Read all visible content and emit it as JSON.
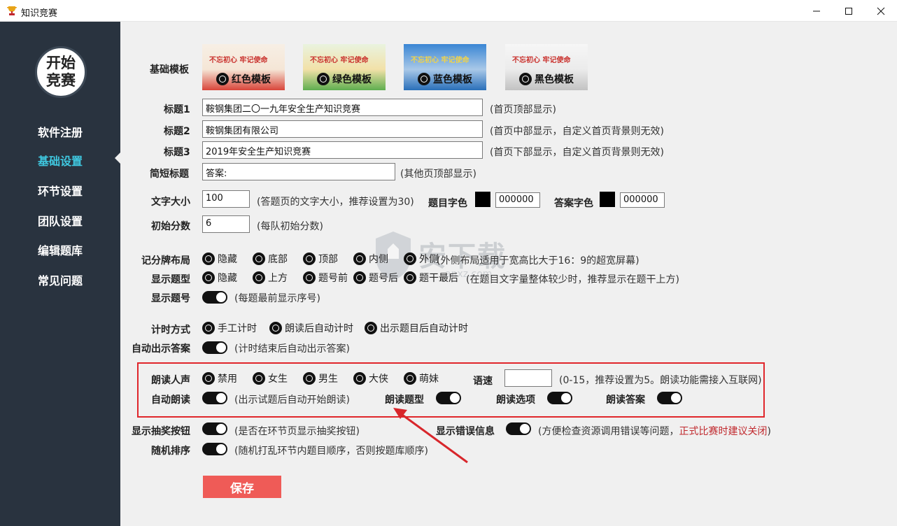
{
  "window": {
    "title": "知识竞赛"
  },
  "sidebar": {
    "logo_text": "开始竞赛",
    "items": [
      {
        "label": "软件注册",
        "active": false
      },
      {
        "label": "基础设置",
        "active": true
      },
      {
        "label": "环节设置",
        "active": false
      },
      {
        "label": "团队设置",
        "active": false
      },
      {
        "label": "编辑题库",
        "active": false
      },
      {
        "label": "常见问题",
        "active": false
      }
    ]
  },
  "template": {
    "label": "基础模板",
    "options": [
      {
        "label": "红色模板",
        "banner_text": "不忘初心 牢记使命",
        "color": "#d9453a"
      },
      {
        "label": "绿色模板",
        "banner_text": "不忘初心 牢记使命",
        "color": "#5fae4f"
      },
      {
        "label": "蓝色模板",
        "banner_text": "不忘初心 牢记使命",
        "color": "#2a6fb9"
      },
      {
        "label": "黑色模板",
        "banner_text": "不忘初心 牢记使命",
        "color": "#c2c2c2"
      }
    ]
  },
  "titles": {
    "title1": {
      "label": "标题1",
      "value": "鞍钢集团二〇一九年安全生产知识竞赛",
      "hint": "(首页顶部显示)"
    },
    "title2": {
      "label": "标题2",
      "value": "鞍钢集团有限公司",
      "hint": "(首页中部显示，自定义首页背景则无效)"
    },
    "title3": {
      "label": "标题3",
      "value": "2019年安全生产知识竞赛",
      "hint": "(首页下部显示，自定义首页背景则无效)"
    },
    "short": {
      "label": "简短标题",
      "value": "答案:",
      "hint": "(其他页顶部显示)"
    }
  },
  "font": {
    "size_label": "文字大小",
    "size_value": "100",
    "size_hint": "(答题页的文字大小，推荐设置为30)",
    "question_color_label": "题目字色",
    "question_color_value": "000000",
    "answer_color_label": "答案字色",
    "answer_color_value": "000000"
  },
  "score": {
    "label": "初始分数",
    "value": "6",
    "hint": "(每队初始分数)"
  },
  "scoreboard": {
    "label": "记分牌布局",
    "options": [
      "隐藏",
      "底部",
      "顶部",
      "内侧",
      "外侧"
    ],
    "hint": "(外侧布局适用于宽高比大于16：9的超宽屏幕)"
  },
  "question_type": {
    "label": "显示题型",
    "options": [
      "隐藏",
      "上方",
      "题号前",
      "题号后",
      "题干最后"
    ],
    "hint": "(在题目文字量整体较少时，推荐显示在题干上方)"
  },
  "question_number": {
    "label": "显示题号",
    "hint": "(每题最前显示序号)"
  },
  "timing": {
    "label": "计时方式",
    "options": [
      "手工计时",
      "朗读后自动计时",
      "出示题目后自动计时"
    ]
  },
  "auto_answer": {
    "label": "自动出示答案",
    "hint": "(计时结束后自动出示答案)"
  },
  "voice": {
    "label": "朗读人声",
    "options": [
      "禁用",
      "女生",
      "男生",
      "大侠",
      "萌妹"
    ],
    "speed_label": "语速",
    "speed_value": "",
    "speed_hint": "(0-15，推荐设置为5。朗读功能需接入互联网)",
    "auto_read_label": "自动朗读",
    "auto_read_hint": "(出示试题后自动开始朗读)",
    "read_type_label": "朗读题型",
    "read_options_label": "朗读选项",
    "read_answer_label": "朗读答案"
  },
  "lottery": {
    "label": "显示抽奖按钮",
    "hint": "(是否在环节页显示抽奖按钮)"
  },
  "errors": {
    "label": "显示错误信息",
    "hint": "(方便检查资源调用错误等问题，",
    "hint_red": "正式比赛时建议关闭",
    "hint_end": ")"
  },
  "shuffle": {
    "label": "随机排序",
    "hint": "(随机打乱环节内题目顺序，否则按题库顺序)"
  },
  "save_label": "保存",
  "watermark_text": "安下载",
  "watermark_sub": "anxz.com"
}
